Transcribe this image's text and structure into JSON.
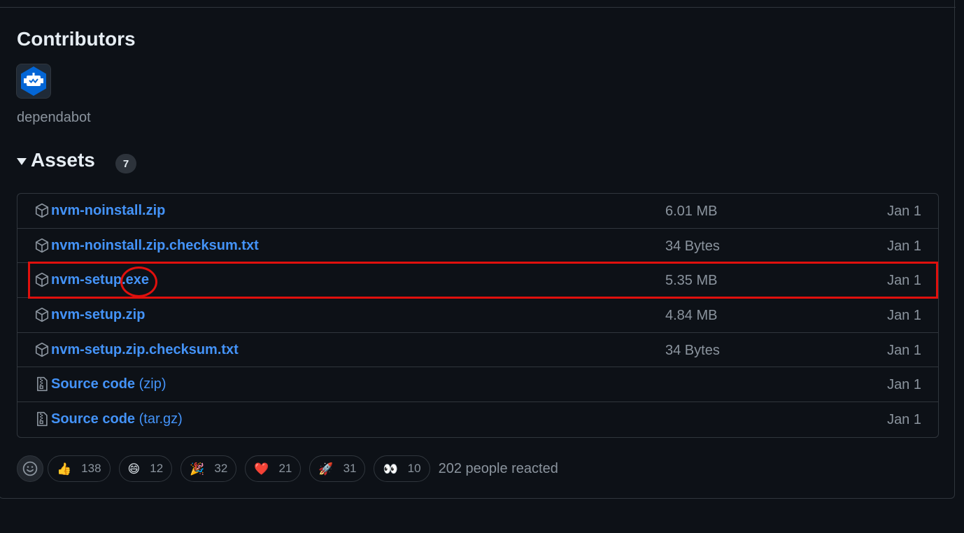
{
  "contributors": {
    "title": "Contributors",
    "items": [
      {
        "name": "dependabot"
      }
    ]
  },
  "assets": {
    "title": "Assets",
    "count": "7",
    "items": [
      {
        "name": "nvm-noinstall.zip",
        "suffix": "",
        "size": "6.01 MB",
        "date": "Jan 1",
        "icon": "package-icon"
      },
      {
        "name": "nvm-noinstall.zip.checksum.txt",
        "suffix": "",
        "size": "34 Bytes",
        "date": "Jan 1",
        "icon": "package-icon"
      },
      {
        "name": "nvm-setup.exe",
        "suffix": "",
        "size": "5.35 MB",
        "date": "Jan 1",
        "icon": "package-icon"
      },
      {
        "name": "nvm-setup.zip",
        "suffix": "",
        "size": "4.84 MB",
        "date": "Jan 1",
        "icon": "package-icon"
      },
      {
        "name": "nvm-setup.zip.checksum.txt",
        "suffix": "",
        "size": "34 Bytes",
        "date": "Jan 1",
        "icon": "package-icon"
      },
      {
        "name": "Source code",
        "suffix": " (zip)",
        "size": "",
        "date": "Jan 1",
        "icon": "file-zip-icon"
      },
      {
        "name": "Source code",
        "suffix": " (tar.gz)",
        "size": "",
        "date": "Jan 1",
        "icon": "file-zip-icon"
      }
    ]
  },
  "reactions": {
    "items": [
      {
        "emoji": "👍",
        "count": "138",
        "icon": "thumbs-up-icon"
      },
      {
        "emoji": "😄",
        "count": "12",
        "icon": "smile-icon"
      },
      {
        "emoji": "🎉",
        "count": "32",
        "icon": "tada-icon"
      },
      {
        "emoji": "❤️",
        "count": "21",
        "icon": "heart-icon"
      },
      {
        "emoji": "🚀",
        "count": "31",
        "icon": "rocket-icon"
      },
      {
        "emoji": "👀",
        "count": "10",
        "icon": "eyes-icon"
      }
    ],
    "summary": "202 people reacted"
  },
  "colors": {
    "background": "#0d1117",
    "link": "#4493f8",
    "muted": "#8b949e",
    "border": "#30363d",
    "annotation": "#e0100d"
  }
}
